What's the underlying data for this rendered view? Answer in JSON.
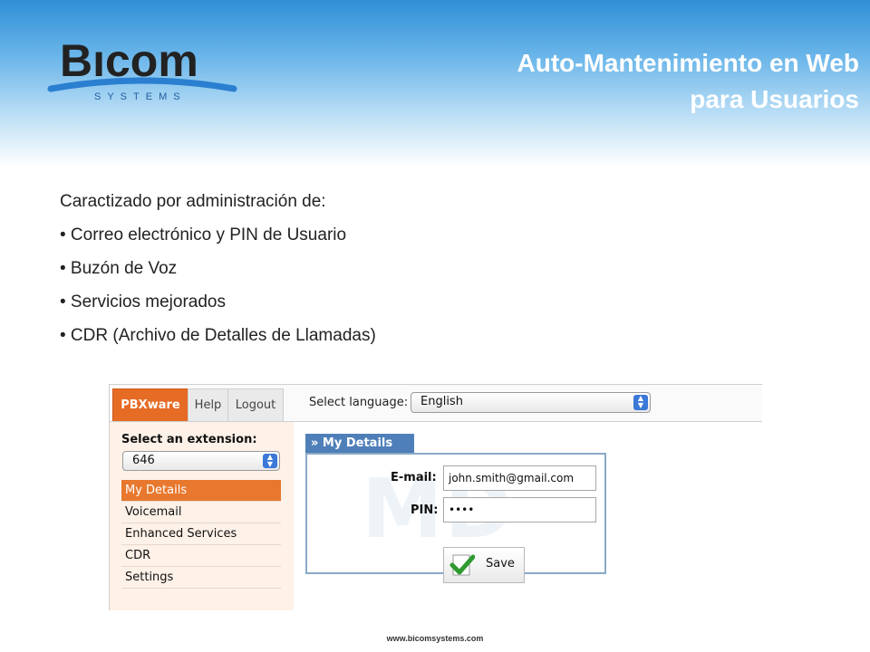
{
  "slide": {
    "title_line1": "Auto-Mantenimiento en Web",
    "title_line2": "para Usuarios",
    "logo_text": "Bıcom",
    "logo_subtext": "SYSTEMS",
    "intro": "Caractizado por administración de:",
    "bullets": [
      "• Correo electrónico y PIN de Usuario",
      "• Buzón de Voz",
      "• Servicios mejorados",
      "• CDR (Archivo de Detalles de Llamadas)"
    ],
    "footer_url": "www.bicomsystems.com"
  },
  "app": {
    "tabs": [
      "PBXware",
      "Help",
      "Logout"
    ],
    "language_label": "Select language:",
    "language_value": "English",
    "extension_label": "Select an extension:",
    "extension_value": "646",
    "nav": [
      "My Details",
      "Voicemail",
      "Enhanced Services",
      "CDR",
      "Settings"
    ],
    "details_tab": "» My Details",
    "watermark": "MD",
    "email_label": "E-mail:",
    "email_value": "john.smith@gmail.com",
    "pin_label": "PIN:",
    "pin_value": "••••",
    "save_label": "Save"
  },
  "colors": {
    "accent_orange": "#e8782d",
    "accent_blue": "#4f7fb8",
    "header_blue": "#2f8fd6"
  }
}
